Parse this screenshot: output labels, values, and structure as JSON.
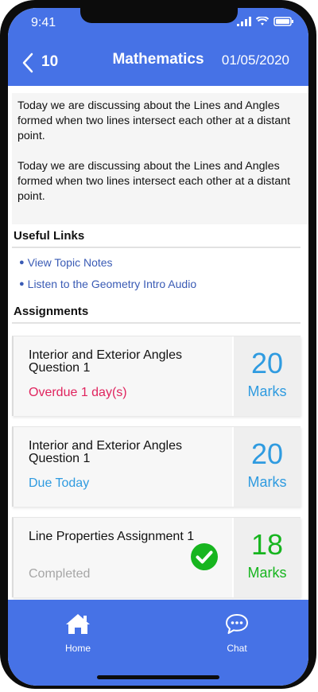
{
  "status_bar": {
    "time": "9:41"
  },
  "header": {
    "back_count": "10",
    "title": "Mathematics",
    "date": "01/05/2020"
  },
  "intro": {
    "paragraphs": [
      "Today we are discussing about the Lines and Angles formed when two lines intersect each other at a distant point.",
      "Today we are discussing about the Lines and Angles formed when two lines intersect each other at a distant point."
    ]
  },
  "useful_links": {
    "heading": "Useful Links",
    "items": [
      {
        "label": "View Topic Notes"
      },
      {
        "label": "Listen to the Geometry Intro Audio"
      }
    ]
  },
  "assignments": {
    "heading": "Assignments",
    "items": [
      {
        "title": "Interior and Exterior Angles Question 1",
        "status": "Overdue 1 day(s)",
        "status_color": "#e0245e",
        "marks": "20",
        "marks_label": "Marks",
        "marks_color": "#2f9be0"
      },
      {
        "title": "Interior and Exterior Angles Question 1",
        "status": "Due Today",
        "status_color": "#2f9be0",
        "marks": "20",
        "marks_label": "Marks",
        "marks_color": "#2f9be0"
      },
      {
        "title": "Line Properties Assignment 1",
        "status": "Completed",
        "status_color": "#a6a6a6",
        "marks": "18",
        "marks_label": "Marks",
        "marks_color": "#17b51f",
        "icon": "check-circle-icon"
      }
    ]
  },
  "bottom_nav": {
    "items": [
      {
        "label": "Home",
        "icon": "home-icon"
      },
      {
        "label": "Chat",
        "icon": "chat-icon"
      }
    ]
  },
  "colors": {
    "brand": "#4672e6",
    "link": "#3a5bb5",
    "overdue": "#e0245e",
    "due": "#2f9be0",
    "completed_check": "#17b51f"
  }
}
